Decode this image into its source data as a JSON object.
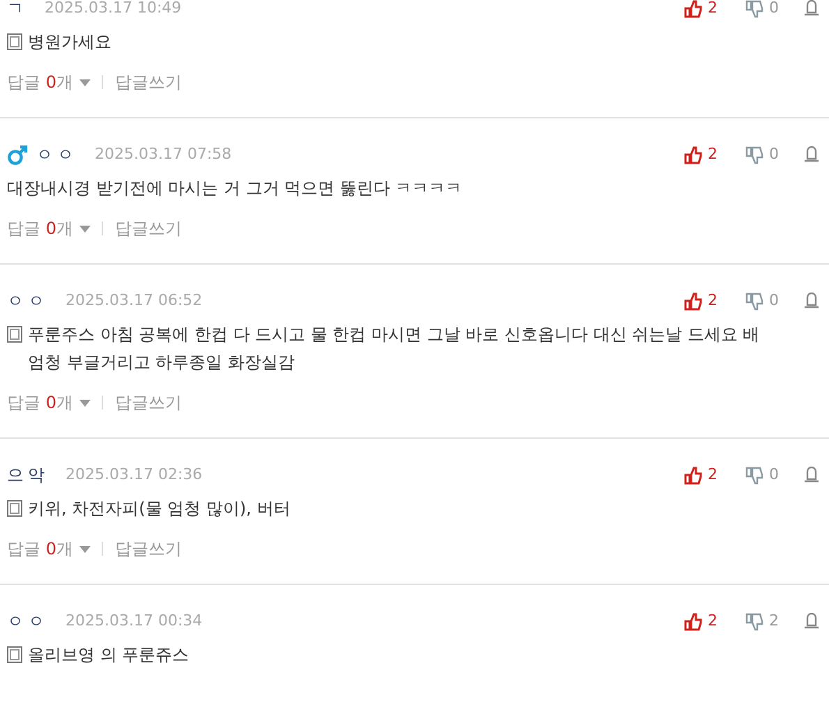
{
  "comments": [
    {
      "author": "ㄱ",
      "male": false,
      "date": "2025.03.17 10:49",
      "memo": true,
      "body": "병원가세요",
      "likes": "2",
      "dislikes": "0",
      "reply": {
        "label": "답글",
        "count": "0",
        "unit": "개",
        "write": "답글쓰기"
      }
    },
    {
      "author": "ㅇㅇ",
      "male": true,
      "date": "2025.03.17 07:58",
      "memo": false,
      "body": "대장내시경 받기전에 마시는 거 그거 먹으면 뚫린다 ㅋㅋㅋㅋ",
      "likes": "2",
      "dislikes": "0",
      "reply": {
        "label": "답글",
        "count": "0",
        "unit": "개",
        "write": "답글쓰기"
      }
    },
    {
      "author": "ㅇㅇ",
      "male": false,
      "date": "2025.03.17 06:52",
      "memo": true,
      "body": "푸룬주스 아침 공복에 한컵 다 드시고 물 한컵 마시면 그날 바로 신호옵니다 대신 쉬는날 드세요 배 엄청 부글거리고 하루종일 화장실감",
      "likes": "2",
      "dislikes": "0",
      "reply": {
        "label": "답글",
        "count": "0",
        "unit": "개",
        "write": "답글쓰기"
      }
    },
    {
      "author": "으악",
      "male": false,
      "date": "2025.03.17 02:36",
      "memo": true,
      "body": "키위, 차전자피(물 엄청 많이), 버터",
      "likes": "2",
      "dislikes": "0",
      "reply": {
        "label": "답글",
        "count": "0",
        "unit": "개",
        "write": "답글쓰기"
      }
    },
    {
      "author": "ㅇㅇ",
      "male": false,
      "date": "2025.03.17 00:34",
      "memo": true,
      "body": "올리브영 의 푸룬쥬스",
      "likes": "2",
      "dislikes": "2"
    }
  ]
}
